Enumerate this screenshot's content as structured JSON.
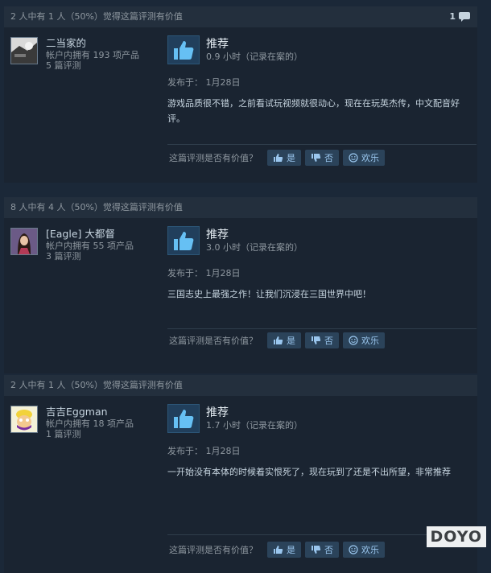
{
  "reviews": [
    {
      "helpful_text": "2 人中有 1 人（50%）觉得这篇评测有价值",
      "comment_count": "1",
      "author_name": "二当家的",
      "products_owned": "帐户内拥有 193 项产品",
      "review_count": "5 篇评测",
      "recommendation": "推荐",
      "hours": "0.9 小时（记录在案的）",
      "posted": "发布于：  1月28日",
      "content": "游戏品质很不错，之前看试玩视频就很动心，现在在玩英杰传，中文配音好评。"
    },
    {
      "helpful_text": "8 人中有 4 人（50%）觉得这篇评测有价值",
      "comment_count": "",
      "author_name": "[Eagle] 大都督",
      "products_owned": "帐户内拥有 55 项产品",
      "review_count": "3 篇评测",
      "recommendation": "推荐",
      "hours": "3.0 小时（记录在案的）",
      "posted": "发布于：  1月28日",
      "content": "三国志史上最强之作！让我们沉浸在三国世界中吧！"
    },
    {
      "helpful_text": "2 人中有 1 人（50%）觉得这篇评测有价值",
      "comment_count": "",
      "author_name": "吉吉Eggman",
      "products_owned": "帐户内拥有 18 项产品",
      "review_count": "1 篇评测",
      "recommendation": "推荐",
      "hours": "1.7 小时（记录在案的）",
      "posted": "发布于：  1月28日",
      "content": "一开始没有本体的时候着实恨死了，现在玩到了还是不出所望，非常推荐"
    }
  ],
  "vote": {
    "question": "这篇评测是否有价值？",
    "yes": "是",
    "no": "否",
    "funny": "欢乐"
  },
  "watermark": "DOYO",
  "icons": {
    "comment": "speech-bubble-icon",
    "recommend": "thumbs-up-icon",
    "yes": "thumbs-up-icon",
    "no": "thumbs-down-icon",
    "funny": "smiley-icon"
  },
  "colors": {
    "page_bg": "#1b2838",
    "card_bg": "#1a2431",
    "header_bg": "#232f3d",
    "button_bg": "#2b435a",
    "button_text": "#9ac6ee"
  }
}
